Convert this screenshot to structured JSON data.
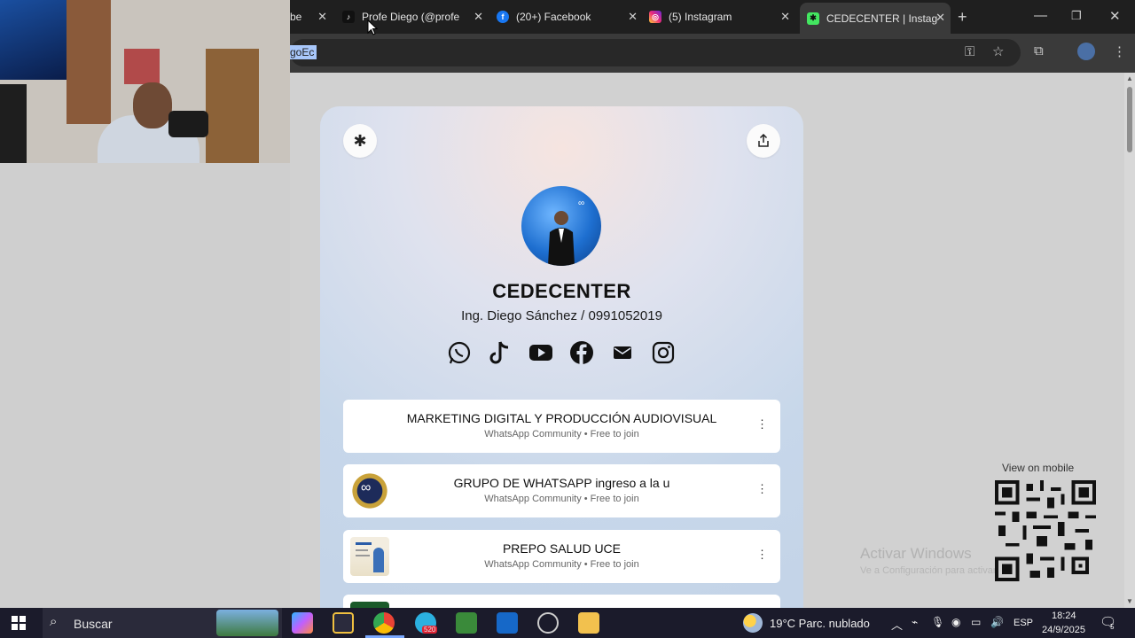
{
  "browser": {
    "tabs": [
      {
        "label": "be"
      },
      {
        "label": "Profe Diego (@profe"
      },
      {
        "label": "(20+) Facebook"
      },
      {
        "label": "(5) Instagram"
      },
      {
        "label": "CEDECENTER | Instag"
      }
    ],
    "address_text": "goEc"
  },
  "profile": {
    "name": "CEDECENTER",
    "subtitle": "Ing. Diego Sánchez / 0991052019",
    "social_icons": [
      "whatsapp-icon",
      "tiktok-icon",
      "youtube-icon",
      "facebook-icon",
      "email-icon",
      "instagram-icon"
    ]
  },
  "links": [
    {
      "title": "MARKETING DIGITAL Y PRODUCCIÓN AUDIOVISUAL",
      "meta": "WhatsApp Community • Free to join"
    },
    {
      "title": "GRUPO DE WHATSAPP ingreso a la u",
      "meta": "WhatsApp Community • Free to join"
    },
    {
      "title": "PREPO SALUD UCE",
      "meta": "WhatsApp Community • Free to join"
    }
  ],
  "qr": {
    "label": "View on mobile"
  },
  "watermark": {
    "line1": "Activar Windows",
    "line2": "Ve a Configuración para activar Windows."
  },
  "taskbar": {
    "search_label": "Buscar",
    "weather": "19°C  Parc. nublado",
    "language": "ESP",
    "time": "18:24",
    "date": "24/9/2025",
    "notification_count": "5",
    "badge_count": "520"
  },
  "colors": {
    "whatsapp": "#25d366",
    "facebook": "#1877f2",
    "instagram": "#e1306c",
    "accent": "#a8c7fa"
  }
}
